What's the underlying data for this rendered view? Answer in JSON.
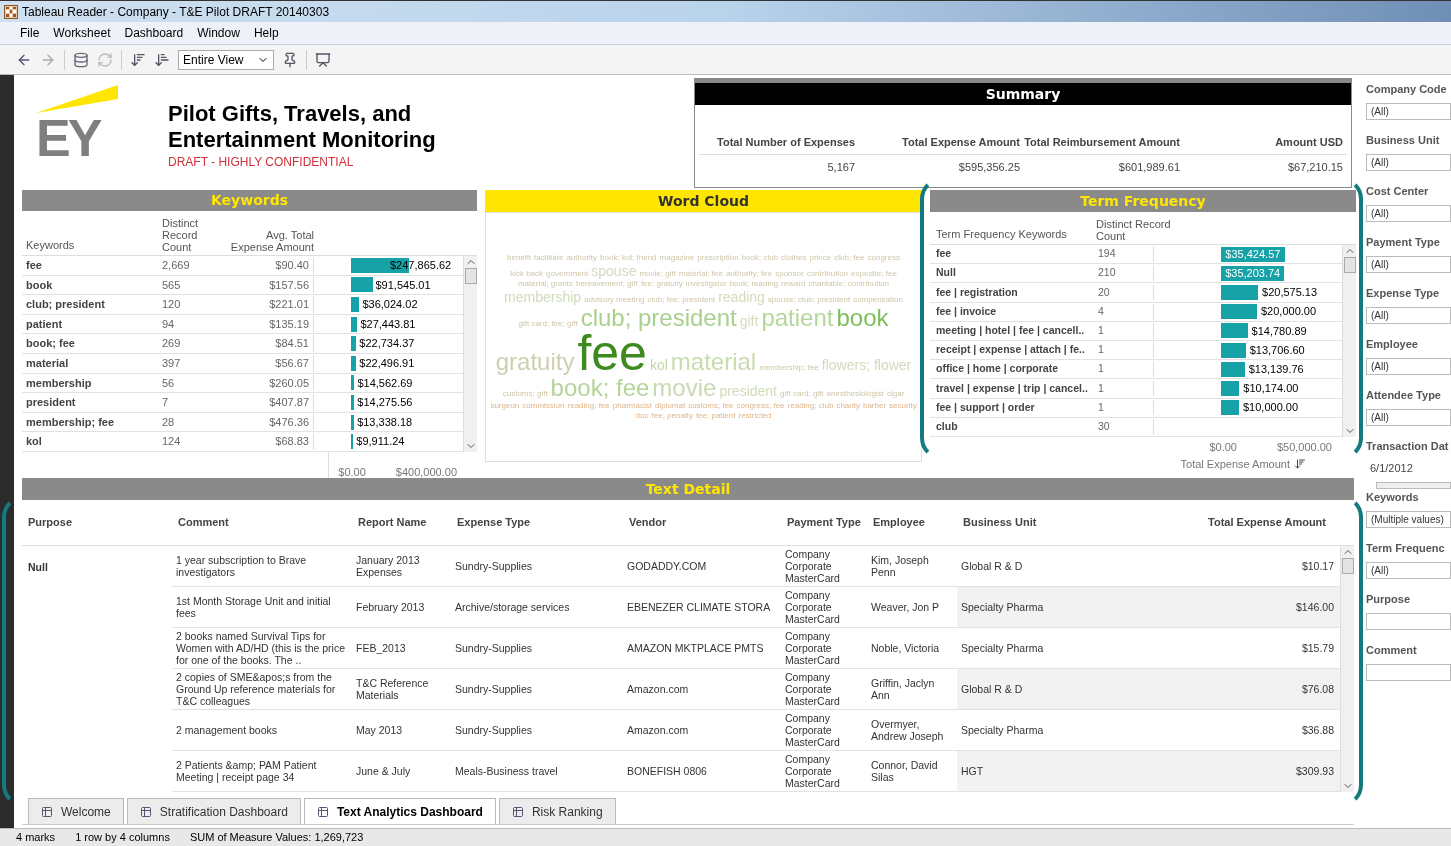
{
  "window": {
    "title": "Tableau Reader - Company - T&E Pilot DRAFT 20140303"
  },
  "menu": [
    "File",
    "Worksheet",
    "Dashboard",
    "Window",
    "Help"
  ],
  "toolbar": {
    "view_select": "Entire View"
  },
  "header": {
    "logo_text": "EY",
    "title": "Pilot Gifts, Travels, and Entertainment Monitoring",
    "subtitle": "DRAFT - HIGHLY CONFIDENTIAL"
  },
  "summary": {
    "title": "Summary",
    "columns": [
      "Total Number of Expenses",
      "Total Expense Amount",
      "Total Reimbursement Amount",
      "Amount USD"
    ],
    "values": [
      "5,167",
      "$595,356.25",
      "$601,989.61",
      "$67,210.15"
    ]
  },
  "keywords": {
    "title": "Keywords",
    "columns": [
      "Keywords",
      "Distinct Record Count",
      "Avg. Total Expense Amount"
    ],
    "axis": [
      "$0.00",
      "$400,000.00"
    ],
    "rows": [
      {
        "keyword": "fee",
        "count": "2,669",
        "avg": "$90.40",
        "total": "$247,865.62"
      },
      {
        "keyword": "book",
        "count": "565",
        "avg": "$157.56",
        "total": "$91,545.01"
      },
      {
        "keyword": "club; president",
        "count": "120",
        "avg": "$221.01",
        "total": "$36,024.02"
      },
      {
        "keyword": "patient",
        "count": "94",
        "avg": "$135.19",
        "total": "$27,443.81"
      },
      {
        "keyword": "book; fee",
        "count": "269",
        "avg": "$84.51",
        "total": "$22,734.37"
      },
      {
        "keyword": "material",
        "count": "397",
        "avg": "$56.67",
        "total": "$22,496.91"
      },
      {
        "keyword": "membership",
        "count": "56",
        "avg": "$260.05",
        "total": "$14,562.69"
      },
      {
        "keyword": "president",
        "count": "7",
        "avg": "$407.87",
        "total": "$14,275.56"
      },
      {
        "keyword": "membership; fee",
        "count": "28",
        "avg": "$476.36",
        "total": "$13,338.18"
      },
      {
        "keyword": "kol",
        "count": "124",
        "avg": "$68.83",
        "total": "$9,911.24"
      }
    ]
  },
  "word_cloud": {
    "title": "Word Cloud",
    "words": [
      {
        "text": "benefit",
        "kind": "s"
      },
      {
        "text": "facilitate",
        "kind": "s"
      },
      {
        "text": "authority",
        "kind": "s"
      },
      {
        "text": "book; kol; friend",
        "kind": "s"
      },
      {
        "text": "magazine",
        "kind": "s"
      },
      {
        "text": "prescription",
        "kind": "s"
      },
      {
        "text": "book; club",
        "kind": "s"
      },
      {
        "text": "clothes",
        "kind": "s"
      },
      {
        "text": "prince",
        "kind": "s"
      },
      {
        "text": "club; fee",
        "kind": "s"
      },
      {
        "text": "congress",
        "kind": "s"
      },
      {
        "text": "kick back",
        "kind": "s"
      },
      {
        "text": "government",
        "kind": "s"
      },
      {
        "text": "spouse",
        "kind": "m",
        "color": "#d8d8c0"
      },
      {
        "text": "movie; gift",
        "kind": "s"
      },
      {
        "text": "material; fee",
        "kind": "s"
      },
      {
        "text": "authority; fee",
        "kind": "s"
      },
      {
        "text": "sponsor",
        "kind": "s"
      },
      {
        "text": "contribution",
        "kind": "s"
      },
      {
        "text": "expedite; fee",
        "kind": "s"
      },
      {
        "text": "material; grants",
        "kind": "s"
      },
      {
        "text": "bereavement; gift",
        "kind": "s"
      },
      {
        "text": "fee; gratuity",
        "kind": "s"
      },
      {
        "text": "investigator",
        "kind": "s"
      },
      {
        "text": "book; reading",
        "kind": "s"
      },
      {
        "text": "reward",
        "kind": "s"
      },
      {
        "text": "charitable; contribution",
        "kind": "s"
      },
      {
        "text": "membership",
        "kind": "m",
        "color": "#cfdcb8"
      },
      {
        "text": "advisory meeting",
        "kind": "s"
      },
      {
        "text": "club; fee; president",
        "kind": "s"
      },
      {
        "text": "reading",
        "kind": "m",
        "color": "#d2ddb8"
      },
      {
        "text": "spouse; club; president",
        "kind": "s"
      },
      {
        "text": "compensation",
        "kind": "s"
      },
      {
        "text": "gift card; fee; gift",
        "kind": "s"
      },
      {
        "text": "club; president",
        "kind": "l",
        "color": "#a9d08e"
      },
      {
        "text": "gift",
        "kind": "m",
        "color": "#d2ddb8"
      },
      {
        "text": "patient",
        "kind": "l",
        "color": "#b5d79a"
      },
      {
        "text": "book",
        "kind": "l",
        "color": "#7fbf5a"
      },
      {
        "text": "gratuity",
        "kind": "l",
        "color": "#cfcfb0"
      },
      {
        "text": "fee",
        "kind": "xl",
        "color": "#3f8a1f"
      },
      {
        "text": "kol",
        "kind": "m",
        "color": "#c0d8a6"
      },
      {
        "text": "material",
        "kind": "l",
        "color": "#c8dcae"
      },
      {
        "text": "membership; fee",
        "kind": "s"
      },
      {
        "text": "flowers; flower",
        "kind": "m",
        "color": "#d6d6c0"
      },
      {
        "text": "customs; gift",
        "kind": "s"
      },
      {
        "text": "book; fee",
        "kind": "l",
        "color": "#b5d49a"
      },
      {
        "text": "movie",
        "kind": "l",
        "color": "#c9dab0"
      },
      {
        "text": "president",
        "kind": "m",
        "color": "#cfdcb8"
      },
      {
        "text": "gift card; gift",
        "kind": "s"
      },
      {
        "text": "anesthesiologist",
        "kind": "s"
      },
      {
        "text": "cigar",
        "kind": "s"
      },
      {
        "text": "surgeon",
        "kind": "t"
      },
      {
        "text": "commission",
        "kind": "t"
      },
      {
        "text": "reading; fee",
        "kind": "t"
      },
      {
        "text": "pharmacist",
        "kind": "t"
      },
      {
        "text": "diplomat",
        "kind": "t"
      },
      {
        "text": "customs; fee",
        "kind": "t"
      },
      {
        "text": "congress; fee",
        "kind": "t"
      },
      {
        "text": "reading; club",
        "kind": "t"
      },
      {
        "text": "charity",
        "kind": "t"
      },
      {
        "text": "barber",
        "kind": "t"
      },
      {
        "text": "security",
        "kind": "t"
      },
      {
        "text": "doc",
        "kind": "t"
      },
      {
        "text": "fee; penalty",
        "kind": "t"
      },
      {
        "text": "fee; patient",
        "kind": "t"
      },
      {
        "text": "restricted",
        "kind": "t"
      }
    ]
  },
  "term_frequency": {
    "title": "Term Frequency",
    "columns": [
      "Term Frequency Keywords",
      "Distinct Record Count"
    ],
    "axis": [
      "$0.00",
      "$50,000.00"
    ],
    "axis_title": "Total Expense Amount",
    "rows": [
      {
        "keyword": "fee",
        "count": "194",
        "total": "$35,424.57",
        "highlighted": true
      },
      {
        "keyword": "Null",
        "count": "210",
        "total": "$35,203.74",
        "highlighted": true
      },
      {
        "keyword": "fee | registration",
        "count": "20",
        "total": "$20,575.13",
        "highlighted": false
      },
      {
        "keyword": "fee | invoice",
        "count": "4",
        "total": "$20,000.00",
        "highlighted": false
      },
      {
        "keyword": "meeting | hotel | fee | cancell..",
        "count": "1",
        "total": "$14,780.89",
        "highlighted": false
      },
      {
        "keyword": "receipt | expense | attach | fe..",
        "count": "1",
        "total": "$13,706.60",
        "highlighted": false
      },
      {
        "keyword": "office | home | corporate",
        "count": "1",
        "total": "$13,139.76",
        "highlighted": false
      },
      {
        "keyword": "travel | expense | trip | cancel..",
        "count": "1",
        "total": "$10,174.00",
        "highlighted": false
      },
      {
        "keyword": "fee | support | order",
        "count": "1",
        "total": "$10,000.00",
        "highlighted": false
      },
      {
        "keyword": "club",
        "count": "30"
      }
    ]
  },
  "text_detail": {
    "title": "Text Detail",
    "columns": [
      "Purpose",
      "Comment",
      "Report Name",
      "Expense Type",
      "Vendor",
      "Payment Type",
      "Employee",
      "Business Unit",
      "Total Expense Amount"
    ],
    "rows": [
      {
        "purpose": "Null",
        "comment": "1 year subscription to Brave investigators",
        "report": "January 2013 Expenses",
        "expense_type": "Sundry-Supplies",
        "vendor": "GODADDY.COM",
        "payment": "Company Corporate MasterCard",
        "employee": "Kim, Joseph Penn",
        "unit": "Global R & D",
        "amount": "$10.17"
      },
      {
        "comment": "1st Month Storage Unit and initial fees",
        "report": "February 2013",
        "expense_type": "Archive/storage services",
        "vendor": "EBENEZER CLIMATE STORA",
        "payment": "Company Corporate MasterCard",
        "employee": "Weaver, Jon P",
        "unit": "Specialty Pharma",
        "amount": "$146.00"
      },
      {
        "comment": "2 books named Survival Tips for Women with AD/HD (this is the price for one of the books. The ..",
        "report": "FEB_2013",
        "expense_type": "Sundry-Supplies",
        "vendor": "AMAZON MKTPLACE PMTS",
        "payment": "Company Corporate MasterCard",
        "employee": "Noble, Victoria",
        "unit": "Specialty Pharma",
        "amount": "$15.79"
      },
      {
        "comment": "2 copies of SME&apos;s from the Ground Up reference materials for T&C colleagues",
        "report": "T&C Reference Materials",
        "expense_type": "Sundry-Supplies",
        "vendor": "Amazon.com",
        "payment": "Company Corporate MasterCard",
        "employee": "Griffin, Jaclyn Ann",
        "unit": "Global R & D",
        "amount": "$76.08"
      },
      {
        "comment": "2 management books",
        "report": "May 2013",
        "expense_type": "Sundry-Supplies",
        "vendor": "Amazon.com",
        "payment": "Company Corporate MasterCard",
        "employee": "Overmyer, Andrew Joseph",
        "unit": "Specialty Pharma",
        "amount": "$36.88"
      },
      {
        "comment": "2 Patients &amp; PAM Patient Meeting | receipt page 34",
        "report": "June & July",
        "expense_type": "Meals-Business travel",
        "vendor": "BONEFISH 0806",
        "payment": "Company Corporate MasterCard",
        "employee": "Connor, David Silas",
        "unit": "HGT",
        "amount": "$309.93"
      }
    ]
  },
  "filters": [
    {
      "label": "Company Code",
      "value": "(All)",
      "kind": "dropdown"
    },
    {
      "label": "Business Unit",
      "value": "(All)",
      "kind": "dropdown"
    },
    {
      "label": "Cost Center",
      "value": "(All)",
      "kind": "dropdown"
    },
    {
      "label": "Payment Type",
      "value": "(All)",
      "kind": "dropdown"
    },
    {
      "label": "Expense Type",
      "value": "(All)",
      "kind": "dropdown"
    },
    {
      "label": "Employee",
      "value": "(All)",
      "kind": "dropdown"
    },
    {
      "label": "Attendee Type",
      "value": "(All)",
      "kind": "dropdown"
    },
    {
      "label": "Transaction Dat",
      "value": "6/1/2012",
      "kind": "slider"
    },
    {
      "label": "Keywords",
      "value": "(Multiple values)",
      "kind": "dropdown"
    },
    {
      "label": "Term Frequenc",
      "value": "(All)",
      "kind": "dropdown"
    },
    {
      "label": "Purpose",
      "kind": "dropdown"
    },
    {
      "label": "Comment",
      "kind": "dropdown"
    }
  ],
  "sheet_tabs": [
    {
      "label": "Welcome",
      "selected": false
    },
    {
      "label": "Stratification Dashboard",
      "selected": false
    },
    {
      "label": "Text Analytics Dashboard",
      "selected": true
    },
    {
      "label": "Risk Ranking",
      "selected": false
    }
  ],
  "status_bar": [
    "4 marks",
    "1 row by 4 columns",
    "SUM of Measure Values: 1,269,723"
  ]
}
